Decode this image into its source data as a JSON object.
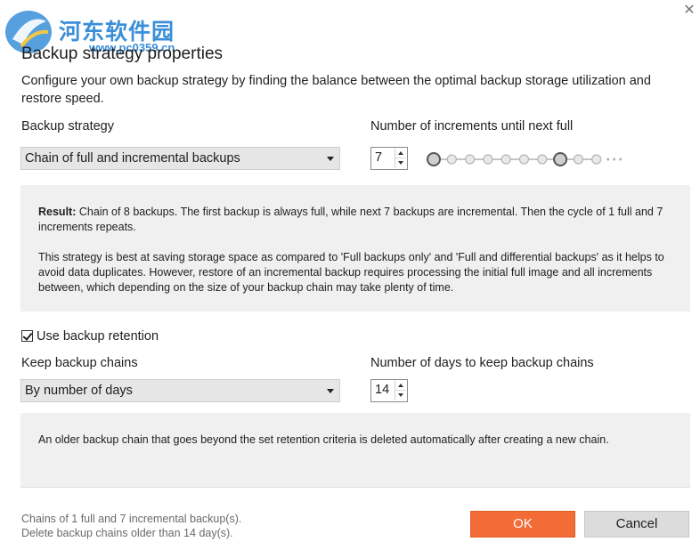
{
  "watermark": {
    "title": "河东软件园",
    "url": "www.pc0359.cn"
  },
  "dialog": {
    "title": "Backup strategy properties",
    "description": "Configure your own backup strategy by finding the balance between the optimal backup storage utilization and restore speed.",
    "close_icon": "close-icon"
  },
  "strategy": {
    "label": "Backup strategy",
    "selected": "Chain of full and incremental backups",
    "increments_label": "Number of increments until next full",
    "increments_value": "7",
    "chain_nodes": 10,
    "chain_full_positions": [
      0,
      7
    ]
  },
  "result": {
    "heading": "Result:",
    "text1": "Chain of 8 backups. The first backup is always full, while next 7 backups are incremental. Then the cycle of 1 full and 7 increments repeats.",
    "text2": "This strategy is best at saving storage space as compared to 'Full backups only' and 'Full and differential backups' as it helps to avoid data duplicates. However, restore of an incremental backup requires processing the initial full image and all increments between, which depending on the size of your backup chain may take plenty of time."
  },
  "retention": {
    "checkbox_label": "Use backup retention",
    "checked": true,
    "keep_label": "Keep backup chains",
    "keep_selected": "By number of days",
    "days_label": "Number of days to keep backup chains",
    "days_value": "14",
    "note": "An older backup chain that goes beyond the set retention criteria is deleted automatically after creating a new chain."
  },
  "footer": {
    "summary1": "Chains of 1 full and 7 incremental backup(s).",
    "summary2": "Delete backup chains older than 14 day(s).",
    "ok_label": "OK",
    "cancel_label": "Cancel"
  },
  "colors": {
    "accent": "#f36c38",
    "info_bg": "#f0f0f0",
    "watermark": "#3a8fd8"
  }
}
